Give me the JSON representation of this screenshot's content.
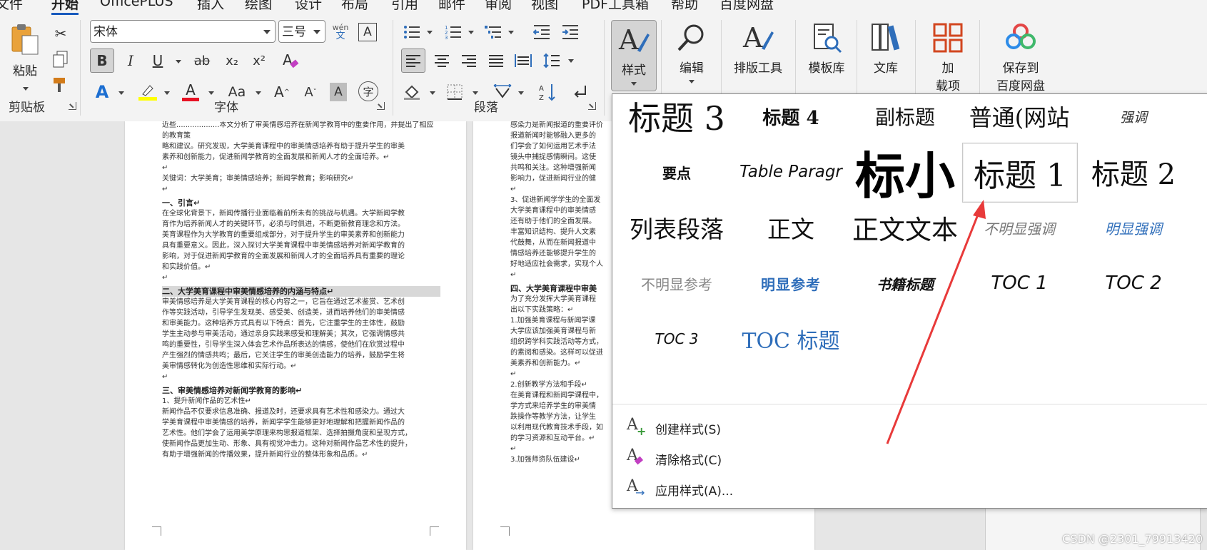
{
  "menubar": {
    "items": [
      "文件",
      "开始",
      "OfficePLUS",
      "插入",
      "绘图",
      "设计",
      "布局",
      "引用",
      "邮件",
      "审阅",
      "视图",
      "PDF工具箱",
      "帮助",
      "百度网盘"
    ],
    "active_index": 1
  },
  "clipboard": {
    "paste_label": "粘贴",
    "group_label": "剪贴板"
  },
  "font": {
    "font_name": "宋体",
    "font_size": "三号",
    "phonetic_top": "wén",
    "phonetic_bottom": "文",
    "bold": "B",
    "italic": "I",
    "underline": "U",
    "strike": "ab",
    "sub": "x₂",
    "sup": "x²",
    "change_case": "Aa",
    "group_label": "字体",
    "highlight_color": "#ffff00",
    "font_color": "#e81123"
  },
  "paragraph": {
    "group_label": "段落"
  },
  "styles_button": {
    "label": "样式"
  },
  "edit_button": {
    "label": "编辑"
  },
  "typeset_button": {
    "label": "排版工具"
  },
  "template_button": {
    "label": "模板库"
  },
  "library_button": {
    "label": "文库"
  },
  "addins_button": {
    "label_1": "加",
    "label_2": "载项"
  },
  "baidu_button": {
    "label_1": "保存到",
    "label_2": "百度网盘"
  },
  "doc": {
    "page1": [
      {
        "t": "近些...................本文分析了审美情感培养在新闻学教育中的重要作用，并提出了相应的教育策",
        "k": "p"
      },
      {
        "t": "略和建议。研究发现，大学美育课程中的审美情感培养有助于提升学生的审美",
        "k": "p"
      },
      {
        "t": "素养和创新能力，促进新闻学教育的全面发展和新闻人才的全面培养。↵",
        "k": "p"
      },
      {
        "t": "↵",
        "k": "pm"
      },
      {
        "t": "关键词：大学美育；审美情感培养；新闻学教育；影响研究↵",
        "k": "p"
      },
      {
        "t": "↵",
        "k": "pm"
      },
      {
        "t": "一、引言↵",
        "k": "h"
      },
      {
        "t": "在全球化背景下，新闻传播行业面临着前所未有的挑战与机遇。大学新闻学教",
        "k": "p"
      },
      {
        "t": "育作为培养新闻人才的关键环节，必须与时俱进，不断更新教育理念和方法。",
        "k": "p"
      },
      {
        "t": "美育课程作为大学教育的重要组成部分，对于提升学生的审美素养和创新能力",
        "k": "p"
      },
      {
        "t": "具有重要意义。因此，深入探讨大学美育课程中审美情感培养对新闻学教育的",
        "k": "p"
      },
      {
        "t": "影响，对于促进新闻学教育的全面发展和新闻人才的全面培养具有重要的理论",
        "k": "p"
      },
      {
        "t": "和实践价值。↵",
        "k": "p"
      },
      {
        "t": "↵",
        "k": "pm"
      },
      {
        "t": "二、大学美育课程中审美情感培养的内涵与特点↵",
        "k": "hl"
      },
      {
        "t": "审美情感培养是大学美育课程的核心内容之一，它旨在通过艺术鉴赏、艺术创",
        "k": "p"
      },
      {
        "t": "作等实践活动，引导学生发现美、感受美、创造美，进而培养他们的审美情感",
        "k": "p"
      },
      {
        "t": "和审美能力。这种培养方式具有以下特点：首先，它注重学生的主体性，鼓励",
        "k": "p"
      },
      {
        "t": "学生主动参与审美活动，通过亲身实践来感受和理解美；其次，它强调情感共",
        "k": "p"
      },
      {
        "t": "鸣的重要性，引导学生深入体会艺术作品所表达的情感，使他们在欣赏过程中",
        "k": "p"
      },
      {
        "t": "产生强烈的情感共鸣；最后，它关注学生的审美创造能力的培养，鼓励学生将",
        "k": "p"
      },
      {
        "t": "美审情感转化为创造性思维和实际行动。↵",
        "k": "p"
      },
      {
        "t": "↵",
        "k": "pm"
      },
      {
        "t": "三、审美情感培养对新闻学教育的影响↵",
        "k": "h"
      },
      {
        "t": "1、提升新闻作品的艺术性↵",
        "k": "p"
      },
      {
        "t": "新闻作品不仅要求信息准确、报道及时，还要求具有艺术性和感染力。通过大",
        "k": "p"
      },
      {
        "t": "学美育课程中审美情感的培养，新闻学学生能够更好地理解和把握新闻作品的",
        "k": "p"
      },
      {
        "t": "艺术性。他们学会了运用美学原理来构思报道框架、选择拍摄角度和呈现方式，",
        "k": "p"
      },
      {
        "t": "使新闻作品更加生动、形象、具有视觉冲击力。这种对新闻作品艺术性的提升，",
        "k": "p"
      },
      {
        "t": "有助于增强新闻的传播效果，提升新闻行业的整体形象和品质。↵",
        "k": "p"
      }
    ],
    "page2": [
      {
        "t": "感染力是新闻报道的重要评价",
        "k": "p"
      },
      {
        "t": "报道新闻时能够融入更多的",
        "k": "p"
      },
      {
        "t": "们学会了如何运用艺术手法",
        "k": "p"
      },
      {
        "t": "镜头中捕捉感情瞬间。这使",
        "k": "p"
      },
      {
        "t": "共鸣和关注。这种增强新闻",
        "k": "p"
      },
      {
        "t": "影响力，促进新闻行业的健",
        "k": "p"
      },
      {
        "t": "↵",
        "k": "pm"
      },
      {
        "t": "3、促进新闻学学生的全面发",
        "k": "p"
      },
      {
        "t": "大学美育课程中的审美情感",
        "k": "p"
      },
      {
        "t": "还有助于他们的全面发展。",
        "k": "p"
      },
      {
        "t": "丰富知识结构、提升人文素",
        "k": "p"
      },
      {
        "t": "代鼓舞，从而在新闻报道中",
        "k": "p"
      },
      {
        "t": "情感培养还能够提升学生的",
        "k": "p"
      },
      {
        "t": "好地适应社会需求，实现个人",
        "k": "p"
      },
      {
        "t": "↵",
        "k": "pm"
      },
      {
        "t": "四、大学美育课程中审美",
        "k": "h"
      },
      {
        "t": "为了充分发挥大学美育课程",
        "k": "p"
      },
      {
        "t": "出以下实践策略：↵",
        "k": "p"
      },
      {
        "t": "1.加强美育课程与新闻学课",
        "k": "p"
      },
      {
        "t": "大学应该加强美育课程与新",
        "k": "p"
      },
      {
        "t": "组织跨学科实践活动等方式，",
        "k": "p"
      },
      {
        "t": "的素阅和感染。这样可以促进",
        "k": "p"
      },
      {
        "t": "美素养和创新能力。↵",
        "k": "p"
      },
      {
        "t": "↵",
        "k": "pm"
      },
      {
        "t": "2.创新教学方法和手段↵",
        "k": "p"
      },
      {
        "t": "在美育课程和新闻学课程中，",
        "k": "p"
      },
      {
        "t": "学方式来培养学生的审美情",
        "k": "p"
      },
      {
        "t": "跌操作等教学方法，让学生",
        "k": "p"
      },
      {
        "t": "以利用现代教育技术手段，如",
        "k": "p"
      },
      {
        "t": "的学习资源和互动平台。↵",
        "k": "p"
      },
      {
        "t": "↵",
        "k": "pm"
      },
      {
        "t": "3.加强师资队伍建设↵",
        "k": "p"
      }
    ]
  },
  "gallery": {
    "styles": [
      {
        "label": "标题 3",
        "kind": "h3"
      },
      {
        "label": "标题 4",
        "kind": "h4"
      },
      {
        "label": "副标题",
        "kind": "sub"
      },
      {
        "label": "普通(网站",
        "kind": "web"
      },
      {
        "label": "强调",
        "kind": "emph"
      },
      {
        "label": "要点",
        "kind": "strong"
      },
      {
        "label": "Table Paragr",
        "kind": "tp"
      },
      {
        "label": "标小",
        "kind": "big"
      },
      {
        "label": "标题 1",
        "kind": "h1",
        "selected": true
      },
      {
        "label": "标题 2",
        "kind": "h2"
      },
      {
        "label": "列表段落",
        "kind": "list"
      },
      {
        "label": "正文",
        "kind": "normal"
      },
      {
        "label": "正文文本",
        "kind": "body"
      },
      {
        "label": "不明显强调",
        "kind": "subtle"
      },
      {
        "label": "明显强调",
        "kind": "intense"
      },
      {
        "label": "不明显参考",
        "kind": "subref"
      },
      {
        "label": "明显参考",
        "kind": "intref"
      },
      {
        "label": "书籍标题",
        "kind": "book"
      },
      {
        "label": "TOC 1",
        "kind": "toc"
      },
      {
        "label": "TOC 2",
        "kind": "toc"
      },
      {
        "label": "TOC 3",
        "kind": "toc3"
      },
      {
        "label": "TOC 标题",
        "kind": "tochead"
      }
    ],
    "menu": [
      {
        "label": "创建样式(S)",
        "icon": "create-style-icon"
      },
      {
        "label": "清除格式(C)",
        "icon": "clear-format-icon"
      },
      {
        "label": "应用样式(A)...",
        "icon": "apply-style-icon"
      }
    ],
    "accent_blue": "#2f6eba",
    "arrow_color": "#e83a3a"
  },
  "watermark": "CSDN @2301_79913420"
}
